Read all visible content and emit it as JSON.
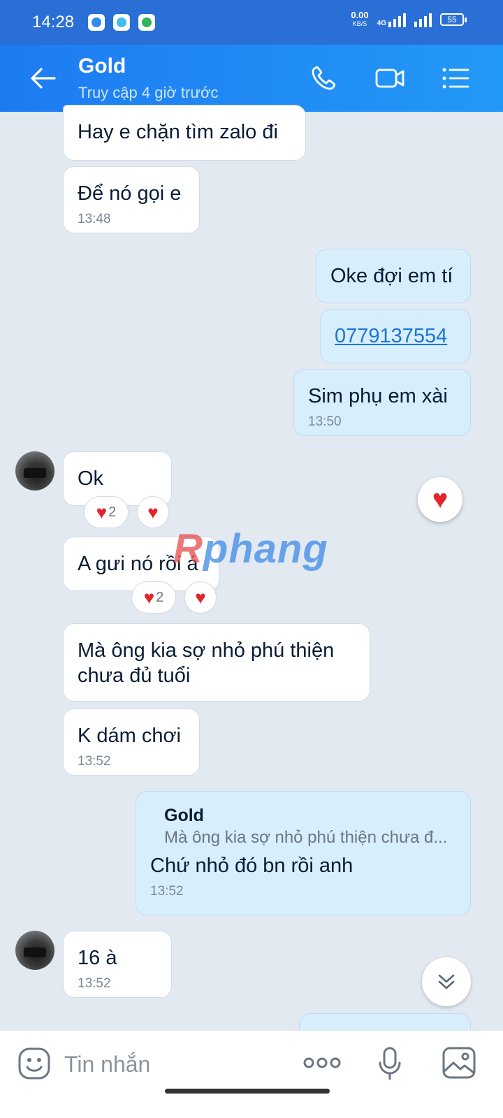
{
  "status_bar": {
    "time": "14:28",
    "net_speed_value": "0.00",
    "net_speed_unit": "KB/S",
    "network_type": "4G",
    "battery": "55"
  },
  "header": {
    "title": "Gold",
    "subtitle": "Truy cập 4 giờ trước",
    "icons": [
      "back-arrow-icon",
      "phone-icon",
      "video-call-icon",
      "menu-list-icon"
    ]
  },
  "messages": [
    {
      "side": "them",
      "text": "Hay e chặn tìm zalo đi"
    },
    {
      "side": "them",
      "text": "Để nó gọi e",
      "time": "13:48"
    },
    {
      "side": "me",
      "text": "Oke đợi em tí"
    },
    {
      "side": "me",
      "text": "0779137554",
      "is_link": true
    },
    {
      "side": "me",
      "text": "Sim phụ em xài",
      "time": "13:50"
    },
    {
      "side": "them",
      "text": "Ok",
      "reaction_count": "2"
    },
    {
      "side": "them",
      "text": "A gưi nó rồi á",
      "reaction_count": "2"
    },
    {
      "side": "them",
      "text_line1": "Mà ông kia sợ nhỏ phú thiện",
      "text_line2": "chưa đủ tuổi"
    },
    {
      "side": "them",
      "text": "K dám chơi",
      "time": "13:52"
    },
    {
      "side": "me",
      "quote_name": "Gold",
      "quote_text": "Mà ông kia sợ nhỏ phú thiện chưa đ...",
      "text": "Chứ nhỏ đó bn rồi anh",
      "time": "13:52"
    },
    {
      "side": "them",
      "text": "16 à",
      "time": "13:52"
    }
  ],
  "watermark": {
    "text": "phang",
    "prefix": "R"
  },
  "input_bar": {
    "placeholder": "Tin nhắn",
    "icons": [
      "emoji-icon",
      "more-options-icon",
      "microphone-icon",
      "image-icon"
    ]
  },
  "colors": {
    "header": "#1d7bf2",
    "status_bar": "#2a6fd6",
    "chat_background": "#e2e9f1",
    "my_bubble": "#d7eefc",
    "their_bubble": "#ffffff",
    "heart": "#e3242b",
    "link": "#1a76d6"
  }
}
